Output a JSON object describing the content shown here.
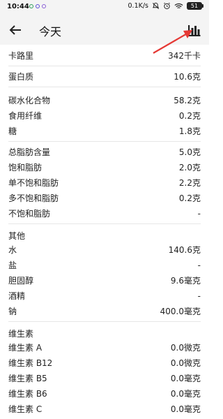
{
  "status_bar": {
    "time": "10:44",
    "speed": "0.1K/s",
    "battery": "51"
  },
  "app_bar": {
    "title": "今天"
  },
  "colors": {
    "accent": "#e53935",
    "text": "#222222",
    "divider": "#e6e6e6"
  },
  "nutrition": {
    "calories": {
      "label": "卡路里",
      "value": "342千卡"
    },
    "protein": {
      "label": "蛋白质",
      "value": "10.6克"
    },
    "carbs": {
      "label": "碳水化合物",
      "value": "58.2克"
    },
    "fiber": {
      "label": "食用纤维",
      "value": "0.2克"
    },
    "sugar": {
      "label": "糖",
      "value": "1.8克"
    },
    "total_fat": {
      "label": "总脂肪含量",
      "value": "5.0克"
    },
    "saturated_fat": {
      "label": "饱和脂肪",
      "value": "2.0克"
    },
    "mono_fat": {
      "label": "单不饱和脂肪",
      "value": "2.2克"
    },
    "poly_fat": {
      "label": "多不饱和脂肪",
      "value": "0.2克"
    },
    "unsat_fat": {
      "label": "不饱和脂肪",
      "value": "-"
    },
    "other_heading": "其他",
    "water": {
      "label": "水",
      "value": "140.6克"
    },
    "salt": {
      "label": "盐",
      "value": "-"
    },
    "cholesterol": {
      "label": "胆固醇",
      "value": "9.6毫克"
    },
    "alcohol": {
      "label": "酒精",
      "value": "-"
    },
    "sodium": {
      "label": "钠",
      "value": "400.0毫克"
    },
    "vitamins_heading": "维生素",
    "vit_a": {
      "label": "维生素 A",
      "value": "0.0微克"
    },
    "vit_b12": {
      "label": "维生素 B12",
      "value": "0.0微克"
    },
    "vit_b5": {
      "label": "维生素 B5",
      "value": "0.0毫克"
    },
    "vit_b6": {
      "label": "维生素 B6",
      "value": "0.0毫克"
    },
    "vit_c": {
      "label": "维生素 C",
      "value": "0.0毫克"
    }
  },
  "icons": {
    "back": "arrow-left-icon",
    "chart": "bar-chart-icon"
  }
}
